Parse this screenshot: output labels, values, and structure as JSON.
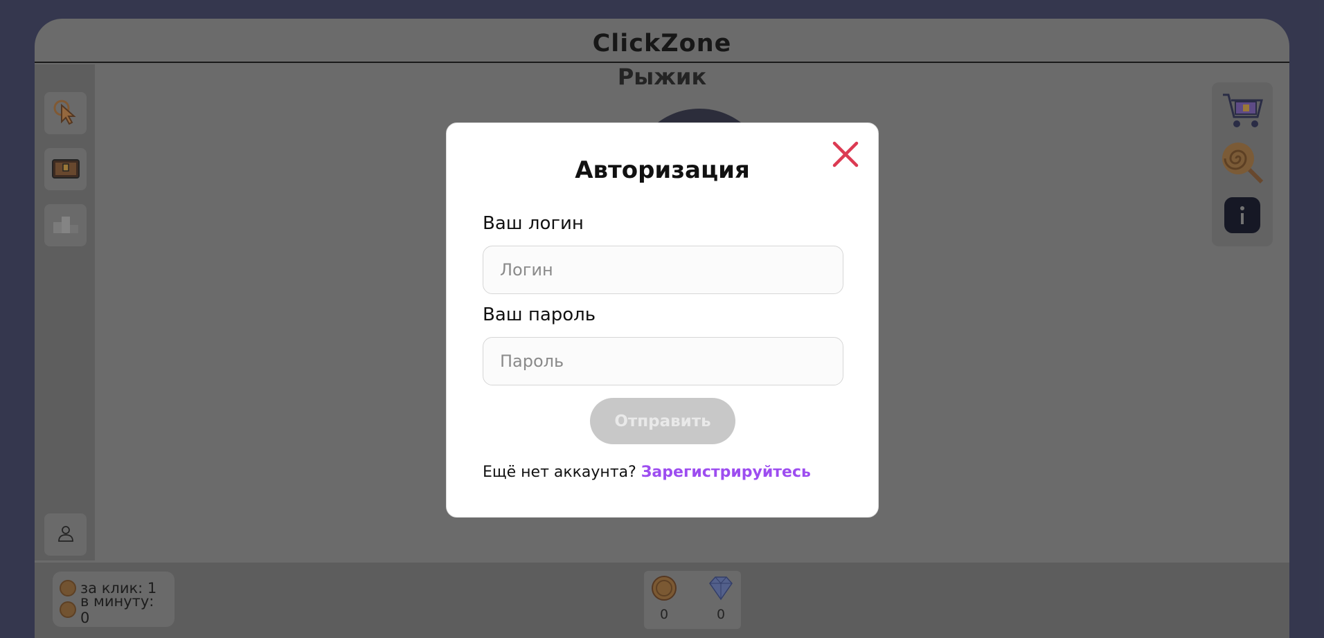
{
  "app": {
    "title": "ClickZone",
    "pet_name": "Рыжик"
  },
  "left_sidebar": {
    "items": [
      {
        "icon": "cursor-click-icon"
      },
      {
        "icon": "locked-chest-icon"
      },
      {
        "icon": "podium-icon"
      }
    ],
    "profile_icon": "user-icon"
  },
  "right_panel": {
    "items": [
      {
        "icon": "shop-cart-icon"
      },
      {
        "icon": "lollipop-icon"
      },
      {
        "icon": "info-icon"
      }
    ]
  },
  "stats": {
    "per_click_label": "за клик: 1",
    "per_minute_label": "в минуту: 0"
  },
  "currency": {
    "coins": "0",
    "gems": "0"
  },
  "auth_modal": {
    "title": "Авторизация",
    "login_label": "Ваш логин",
    "login_placeholder": "Логин",
    "login_value": "",
    "password_label": "Ваш пароль",
    "password_placeholder": "Пароль",
    "password_value": "",
    "submit_label": "Отправить",
    "no_account_text": "Ещё нет аккаунта?",
    "register_link": "Зарегистрируйтесь"
  },
  "colors": {
    "background": "#3c4063",
    "close_icon": "#dc3a52",
    "link": "#9d4df0",
    "submit_disabled": "#c8c8c8"
  }
}
